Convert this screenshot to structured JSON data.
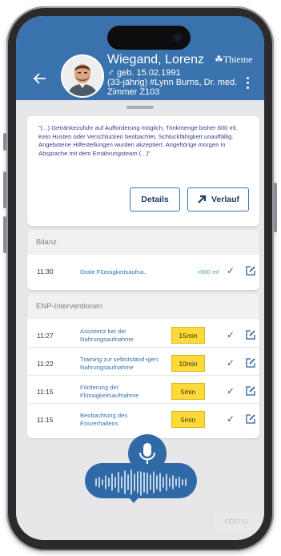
{
  "header": {
    "patient_name": "Wiegand, Lorenz",
    "gender_symbol": "♂",
    "birth": "geb. 15.02.1991",
    "meta": "(33-jährig) #Lynn Burns, Dr. med.",
    "room": "Zimmer Z103",
    "brand": "Thieme",
    "back_icon": "arrow-left-icon",
    "menu_icon": "kebab-menu-icon",
    "colors": {
      "header_bg": "#3a72ad"
    }
  },
  "note": {
    "text": "\"(...) Getränkezufuhr auf Aufforderung möglich, Trinkmenge bisher 600 ml. Kein Husten oder Verschlucken beobachtet, Schluckfähigkeit unauffällig. Angebotene Hilfestellungen wurden akzeptiert. Angehörige morgen in Absprache mit dem Ernährungsteam (...)\"",
    "details_label": "Details",
    "verlauf_label": "Verlauf"
  },
  "bilanz": {
    "title": "Bilanz",
    "rows": [
      {
        "time": "11:30",
        "label": "Orale Flüssigkeitsaufna..",
        "amount": "+600 ml"
      }
    ]
  },
  "enp": {
    "title": "ENP-Interventionen",
    "rows": [
      {
        "time": "11:27",
        "label": "Assistenz bei der Nahrungsaufnahme",
        "duration": "15min"
      },
      {
        "time": "11:22",
        "label": "Training zur selbstständ-igen Nahrungsaufnahme",
        "duration": "10min"
      },
      {
        "time": "11:15",
        "label": "Förderung der Flüssigkeitsaufnahme",
        "duration": "5min"
      },
      {
        "time": "11:15",
        "label": "Beobachtung des Essverhaltens",
        "duration": "5min"
      }
    ]
  },
  "voice": {
    "mic_icon": "microphone-icon",
    "wave_icon": "waveform-icon"
  },
  "footer": {
    "fertig_label": "FERTIG"
  },
  "colors": {
    "accent": "#2f6aa6",
    "duration_pill": "#fdd93a",
    "amount_green": "#4cb05a"
  }
}
